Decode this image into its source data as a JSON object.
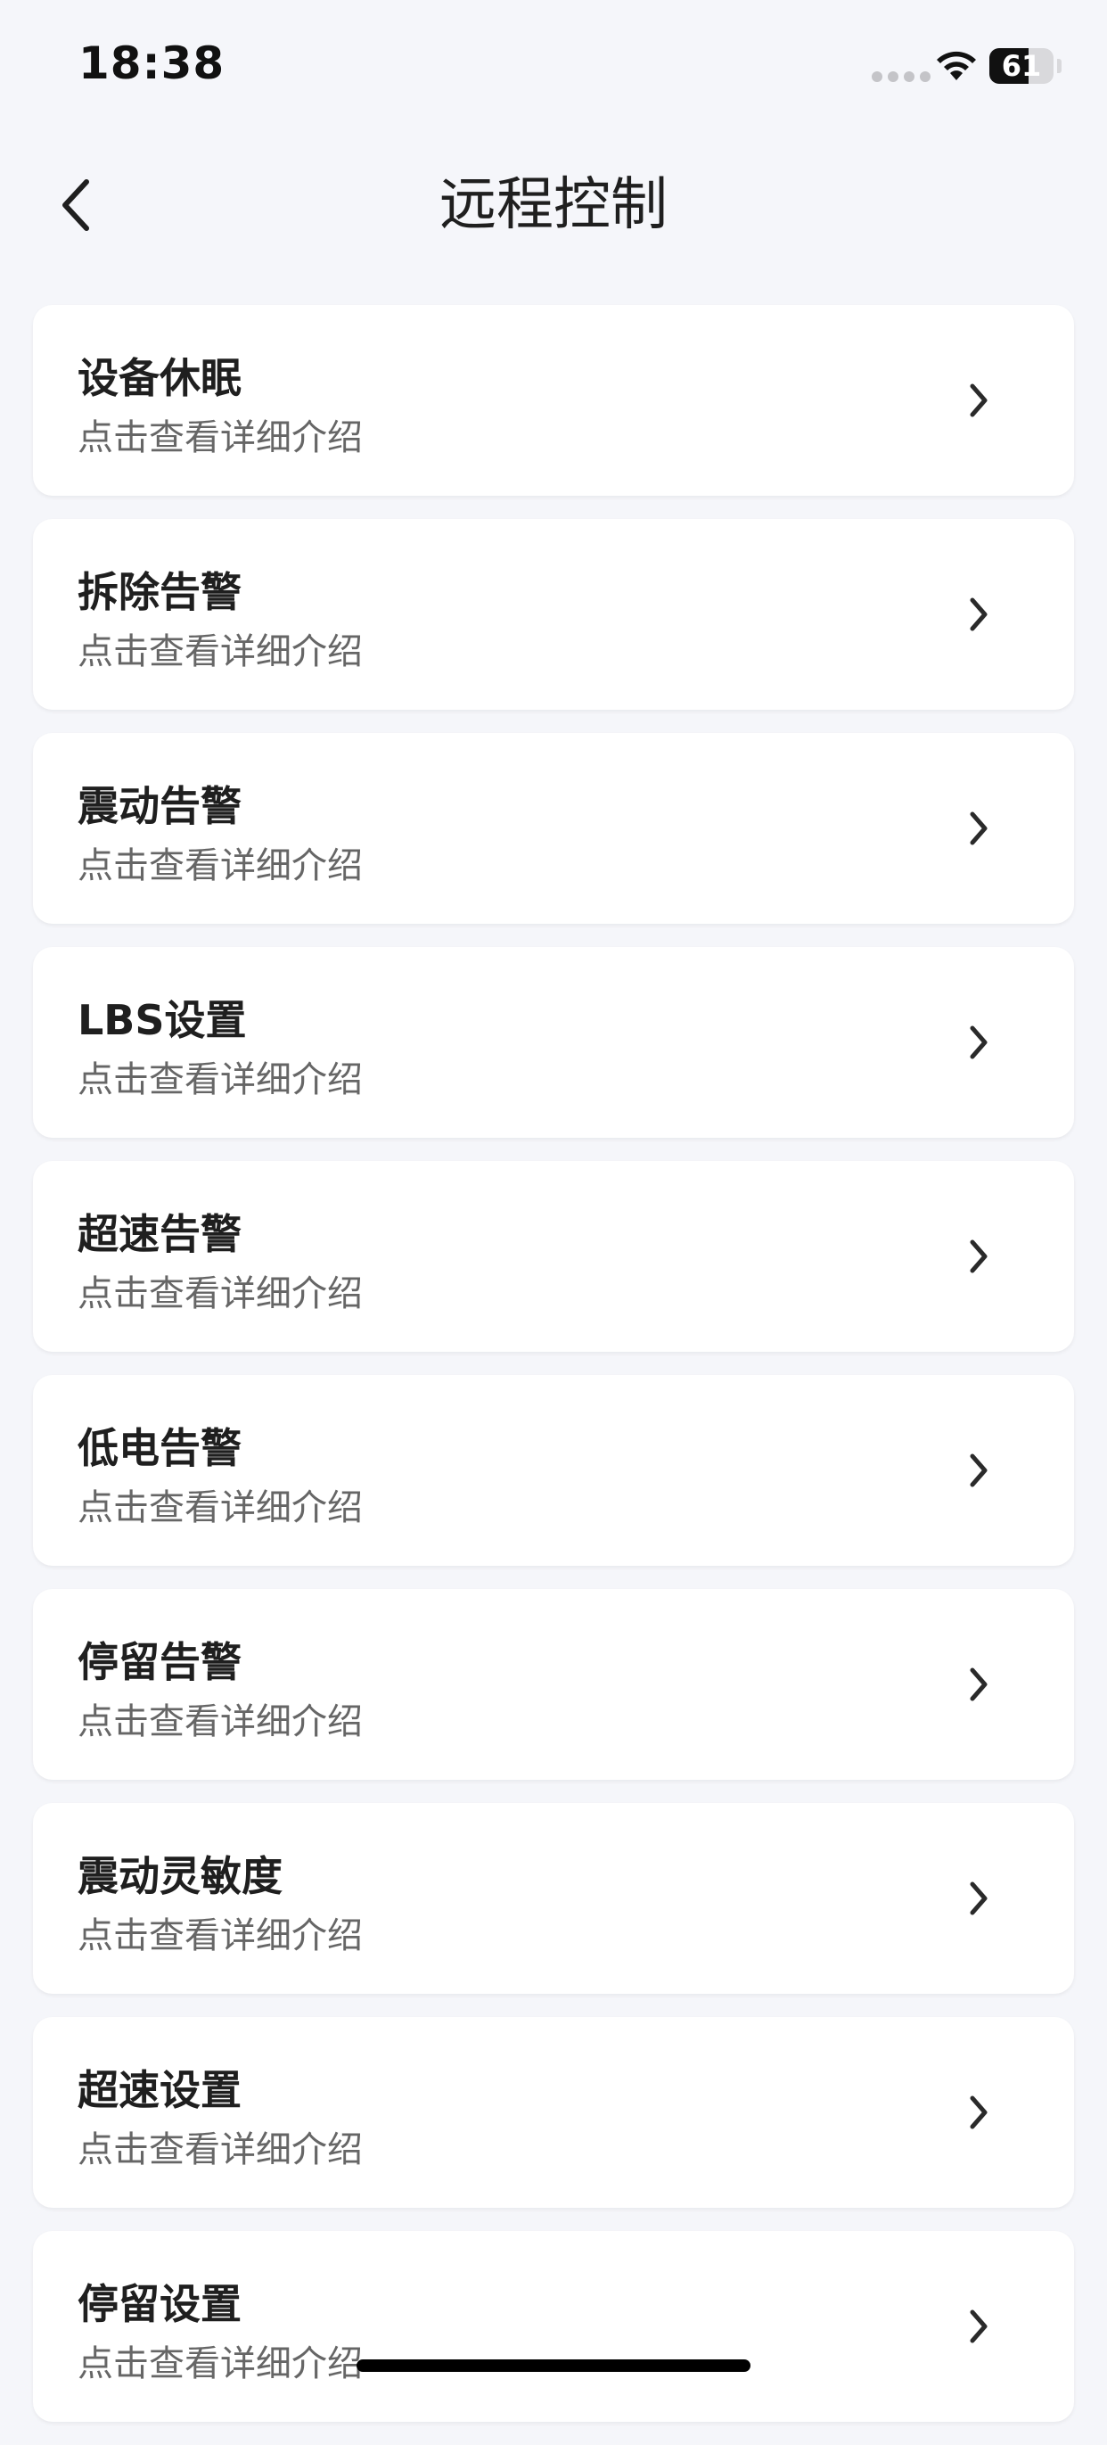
{
  "status": {
    "time": "18:38",
    "battery_level": 61,
    "battery_text": "61",
    "wifi_icon": "wifi-icon",
    "signal_icon": "cellular-signal-icon"
  },
  "header": {
    "title": "远程控制",
    "back_icon": "back-chevron-icon"
  },
  "items": [
    {
      "title": "设备休眠",
      "subtitle": "点击查看详细介绍"
    },
    {
      "title": "拆除告警",
      "subtitle": "点击查看详细介绍"
    },
    {
      "title": "震动告警",
      "subtitle": "点击查看详细介绍"
    },
    {
      "title": "LBS设置",
      "subtitle": "点击查看详细介绍"
    },
    {
      "title": "超速告警",
      "subtitle": "点击查看详细介绍"
    },
    {
      "title": "低电告警",
      "subtitle": "点击查看详细介绍"
    },
    {
      "title": "停留告警",
      "subtitle": "点击查看详细介绍"
    },
    {
      "title": "震动灵敏度",
      "subtitle": "点击查看详细介绍"
    },
    {
      "title": "超速设置",
      "subtitle": "点击查看详细介绍"
    },
    {
      "title": "停留设置",
      "subtitle": "点击查看详细介绍"
    }
  ],
  "colors": {
    "background": "#f5f6fa",
    "card": "#ffffff",
    "title_text": "#1f1f1f",
    "subtitle_text": "#666666"
  }
}
